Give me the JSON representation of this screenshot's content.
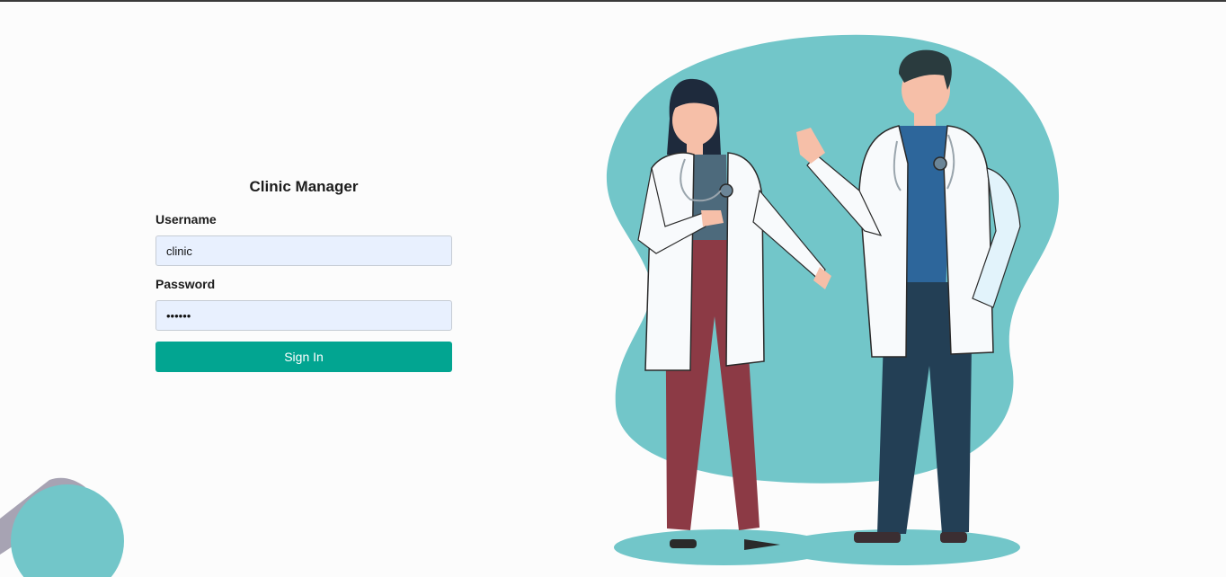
{
  "app": {
    "title": "Clinic Manager"
  },
  "form": {
    "username_label": "Username",
    "username_value": "clinic",
    "password_label": "Password",
    "password_value": "123456",
    "signin_label": "Sign In"
  },
  "colors": {
    "accent": "#02a591",
    "input_bg": "#e8f0fe",
    "blob": "#72c6c9"
  },
  "illustration": {
    "icon": "doctors-illustration"
  }
}
